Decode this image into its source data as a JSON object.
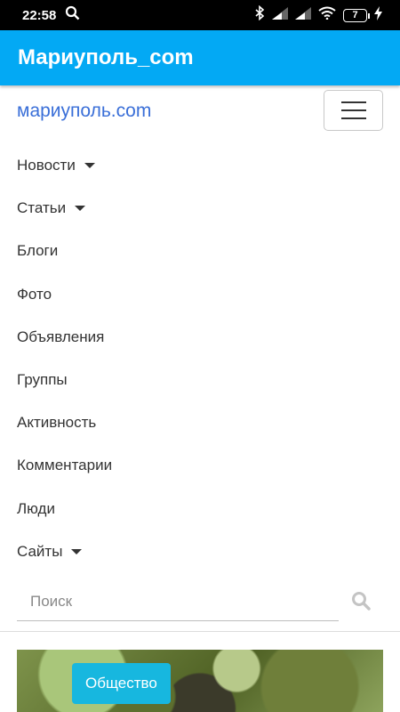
{
  "status_bar": {
    "time": "22:58",
    "battery_level": "7",
    "icons": [
      "search-icon",
      "bluetooth-icon",
      "signal-icon",
      "signal-icon",
      "wifi-icon",
      "battery-icon",
      "charging-icon"
    ]
  },
  "app_bar": {
    "title": "Мариуполь_com"
  },
  "site_nav": {
    "brand": "мариуполь.com",
    "items": [
      {
        "label": "Новости",
        "dropdown": true
      },
      {
        "label": "Статьи",
        "dropdown": true
      },
      {
        "label": "Блоги",
        "dropdown": false
      },
      {
        "label": "Фото",
        "dropdown": false
      },
      {
        "label": "Объявления",
        "dropdown": false
      },
      {
        "label": "Группы",
        "dropdown": false
      },
      {
        "label": "Активность",
        "dropdown": false
      },
      {
        "label": "Комментарии",
        "dropdown": false
      },
      {
        "label": "Люди",
        "dropdown": false
      },
      {
        "label": "Сайты",
        "dropdown": true
      }
    ]
  },
  "search": {
    "placeholder": "Поиск",
    "value": ""
  },
  "featured": {
    "category": "Общество"
  },
  "colors": {
    "app_bar": "#03a9f4",
    "brand_link": "#3a6fd8",
    "badge": "#17b7df"
  }
}
